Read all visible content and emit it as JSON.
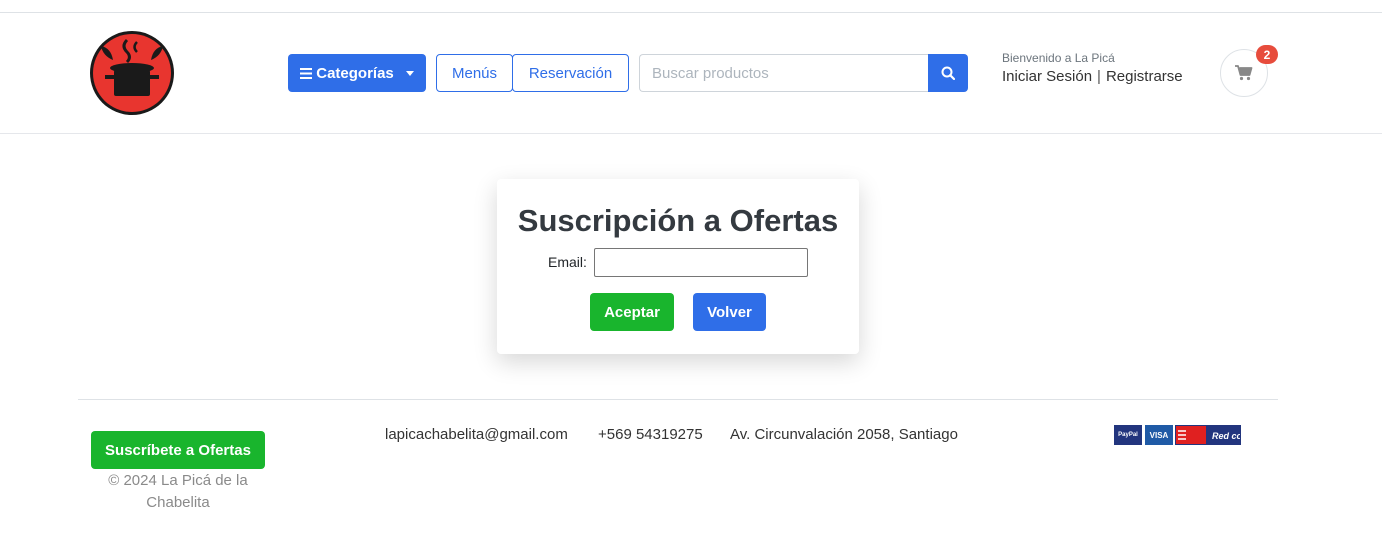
{
  "header": {
    "categories_label": "Categorías",
    "menus_label": "Menús",
    "reservation_label": "Reservación",
    "search_placeholder": "Buscar productos",
    "welcome_text": "Bienvenido a La Picá",
    "login_label": "Iniciar Sesión",
    "separator": "|",
    "register_label": "Registrarse",
    "cart_count": "2"
  },
  "subscription": {
    "title": "Suscripción a Ofertas",
    "email_label": "Email:",
    "email_value": "",
    "accept_label": "Aceptar",
    "back_label": "Volver"
  },
  "footer": {
    "subscribe_label": "Suscríbete a Ofertas",
    "copyright": "© 2024 La Picá de la Chabelita",
    "email": "lapicachabelita@gmail.com",
    "phone": "+569 54319275",
    "address": "Av. Circunvalación 2058, Santiago",
    "payments": {
      "paypal": "PayPal",
      "visa": "VISA",
      "redcompra": "Red compra"
    }
  },
  "colors": {
    "primary": "#2f6ee8",
    "success": "#19b52d",
    "logo_red": "#e8352f",
    "badge": "#e74c3c"
  },
  "icons": {
    "logo": "cooking-pot-logo",
    "menu": "bars-icon",
    "search": "search-icon",
    "cart": "shopping-cart-icon"
  }
}
